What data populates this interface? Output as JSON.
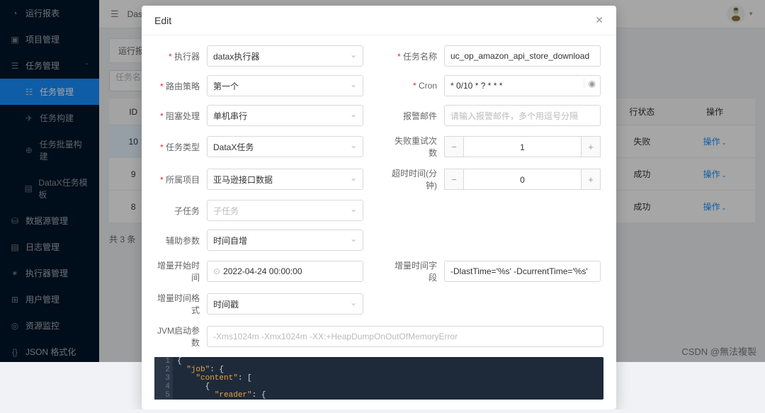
{
  "sidebar": {
    "items": [
      {
        "icon": "dashboard",
        "label": "运行报表"
      },
      {
        "icon": "project",
        "label": "项目管理"
      },
      {
        "icon": "task",
        "label": "任务管理",
        "expanded": true
      },
      {
        "icon": "",
        "label": "任务管理",
        "sub": true,
        "active": true
      },
      {
        "icon": "",
        "label": "任务构建",
        "sub": true
      },
      {
        "icon": "",
        "label": "任务批量构建",
        "sub": true
      },
      {
        "icon": "",
        "label": "DataX任务模板",
        "sub": true
      },
      {
        "icon": "db",
        "label": "数据源管理"
      },
      {
        "icon": "log",
        "label": "日志管理"
      },
      {
        "icon": "exec",
        "label": "执行器管理"
      },
      {
        "icon": "user",
        "label": "用户管理"
      },
      {
        "icon": "monitor",
        "label": "资源监控"
      },
      {
        "icon": "json",
        "label": "JSON 格式化"
      }
    ]
  },
  "header": {
    "breadcrumb": "Das"
  },
  "page": {
    "tab": "运行报表",
    "filter_placeholder": "任务名",
    "columns": {
      "id": "ID",
      "status": "行状态",
      "op": "操作"
    },
    "rows": [
      {
        "id": "10",
        "status": "失败",
        "op": "操作"
      },
      {
        "id": "9",
        "status": "成功",
        "op": "操作"
      },
      {
        "id": "8",
        "status": "成功",
        "op": "操作"
      }
    ],
    "pager": "共 3 条"
  },
  "modal": {
    "title": "Edit",
    "fields": {
      "executor_label": "执行器",
      "executor_value": "datax执行器",
      "taskname_label": "任务名称",
      "taskname_value": "uc_op_amazon_api_store_download",
      "route_label": "路由策略",
      "route_value": "第一个",
      "cron_label": "Cron",
      "cron_value": "* 0/10 * ? * * *",
      "block_label": "阻塞处理",
      "block_value": "单机串行",
      "alarm_label": "报警邮件",
      "alarm_placeholder": "请输入报警邮件，多个用逗号分隔",
      "tasktype_label": "任务类型",
      "tasktype_value": "DataX任务",
      "retry_label": "失败重试次数",
      "retry_value": "1",
      "project_label": "所属项目",
      "project_value": "亚马逊接口数据",
      "timeout_label": "超时时间(分钟)",
      "timeout_value": "0",
      "subtask_label": "子任务",
      "subtask_placeholder": "子任务",
      "aux_label": "辅助参数",
      "aux_value": "时间自增",
      "inc_start_label": "增量开始时间",
      "inc_start_value": "2022-04-24 00:00:00",
      "inc_field_label": "增量时间字段",
      "inc_field_value": "-DlastTime='%s' -DcurrentTime='%s'",
      "inc_fmt_label": "增量时间格式",
      "inc_fmt_value": "时间戳",
      "jvm_label": "JVM启动参数",
      "jvm_placeholder": "-Xms1024m -Xmx1024m -XX:+HeapDumpOnOutOfMemoryError"
    },
    "code": {
      "l1": "{",
      "l2a": "\"job\"",
      "l2b": ": {",
      "l3a": "\"content\"",
      "l3b": ": [",
      "l4": "{",
      "l5a": "\"reader\"",
      "l5b": ": {"
    }
  },
  "watermark": "CSDN @無法複製"
}
